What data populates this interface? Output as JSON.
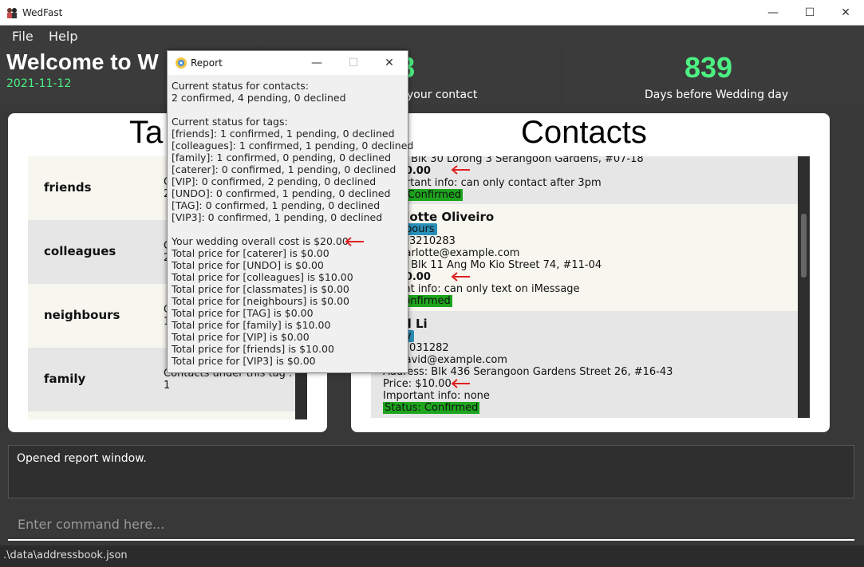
{
  "window": {
    "title": "WedFast",
    "minimize": "—",
    "maximize": "☐",
    "close": "✕"
  },
  "menu": {
    "file": "File",
    "help": "Help"
  },
  "header": {
    "welcome": "Welcome to W",
    "date": "2021-11-12",
    "contact_count": "8",
    "contact_label": "your contact",
    "days_count": "839",
    "days_label": "Days before Wedding day"
  },
  "tags_panel": {
    "title": "Ta",
    "items": [
      {
        "name": "friends",
        "count_label": "C",
        "count_value": "2"
      },
      {
        "name": "colleagues",
        "count_label": "C",
        "count_value": "2"
      },
      {
        "name": "neighbours",
        "count_label": "C",
        "count_value": "1"
      },
      {
        "name": "family",
        "count_label": "Contacts under this tag :",
        "count_value": "1"
      }
    ]
  },
  "contacts_panel": {
    "title": "Contacts",
    "contacts": [
      {
        "name": "",
        "tag": "",
        "phone": "",
        "email": "",
        "address": "ress: Blk 30 Lorong 3 Serangoon Gardens, #07-18",
        "price": ": $10.00",
        "info": "mportant info: can only contact after 3pm",
        "status": "tus: Confirmed"
      },
      {
        "name": "harlotte Oliveiro",
        "tag": "bours",
        "phone": "ne: 93210283",
        "email": "l: charlotte@example.com",
        "address": "ress: Blk 11 Ang Mo Kio Street 74, #11-04",
        "price": ": $10.00",
        "info": "ortant info: can only text on iMessage",
        "status": "s: Confirmed"
      },
      {
        "name": "avid Li",
        "tag": "y",
        "phone": "e: 91031282",
        "email": "l: lidavid@example.com",
        "address": "Address: Blk 436 Serangoon Gardens Street 26, #16-43",
        "price": "Price: $10.00",
        "info": "Important info: none",
        "status": "Status: Confirmed"
      }
    ]
  },
  "result": {
    "text": "Opened report window."
  },
  "command": {
    "placeholder": "Enter command here..."
  },
  "statusbar": {
    "path": ".\\data\\addressbook.json"
  },
  "report": {
    "title": "Report",
    "minimize": "—",
    "maximize": "☐",
    "close": "✕",
    "lines": [
      "Current status for contacts:",
      "2 confirmed, 4 pending, 0 declined",
      "",
      "Current status for tags:",
      "[friends]: 1 confirmed, 1 pending, 0 declined",
      "[colleagues]: 1 confirmed, 1 pending, 0 declined",
      "[family]: 1 confirmed, 0 pending, 0 declined",
      "[caterer]: 0 confirmed, 1 pending, 0 declined",
      "[VIP]: 0 confirmed, 2 pending, 0 declined",
      "[UNDO]: 0 confirmed, 1 pending, 0 declined",
      "[TAG]: 0 confirmed, 1 pending, 0 declined",
      "[VIP3]: 0 confirmed, 1 pending, 0 declined",
      "",
      "Your wedding overall cost is $20.00",
      "Total price for [caterer] is $0.00",
      "Total price for [UNDO] is $0.00",
      "Total price for [colleagues] is $10.00",
      "Total price for [classmates] is $0.00",
      "Total price for [neighbours] is $0.00",
      "Total price for [TAG] is $0.00",
      "Total price for [family] is $10.00",
      "Total price for [VIP] is $0.00",
      "Total price for [friends] is $10.00",
      "Total price for [VIP3] is $0.00"
    ]
  },
  "colors": {
    "accent_green": "#4cf082",
    "status_green": "#1ea51e",
    "tag_blue": "#2a8fb8",
    "annotation_red": "#e02020"
  }
}
